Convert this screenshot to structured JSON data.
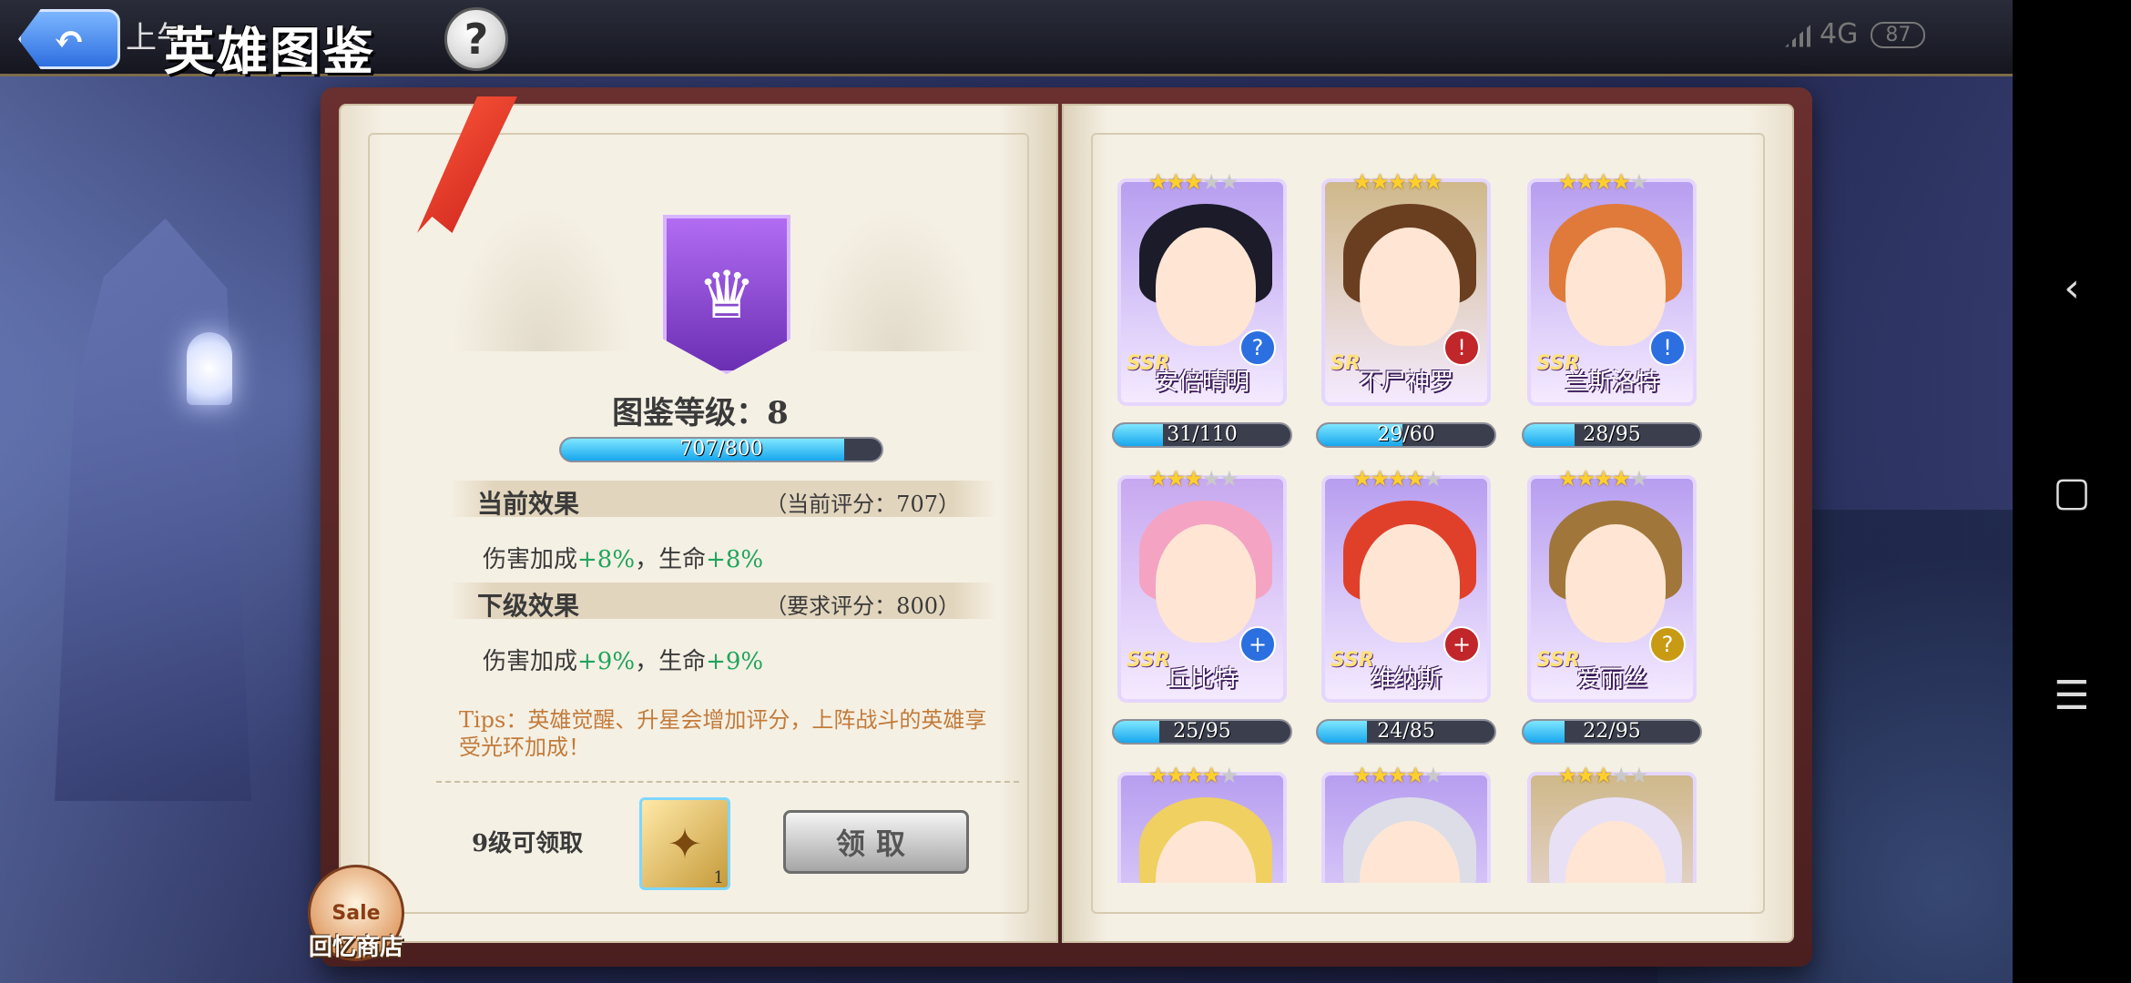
{
  "header": {
    "title": "英雄图鉴",
    "status_time": "上午",
    "network": "4G",
    "battery": "87"
  },
  "left_page": {
    "level_label": "图鉴等级：8",
    "progress_text": "707/800",
    "progress": 0.884,
    "current_effect": {
      "title": "当前效果",
      "score": "（当前评分：707）"
    },
    "current_effect_line": {
      "a": "伤害加成",
      "a_val": "+8%",
      "sep": "，生命",
      "b_val": "+8%"
    },
    "next_effect": {
      "title": "下级效果",
      "score": "（要求评分：800）"
    },
    "next_effect_line": {
      "a": "伤害加成",
      "a_val": "+9%",
      "sep": "，生命",
      "b_val": "+9%"
    },
    "tips": "Tips：英雄觉醒、升星会增加评分，上阵战斗的英雄享受光环加成！",
    "reward_label": "9级可领取",
    "reward_count": "1",
    "claim_button": "领取",
    "sale_badge": "Sale",
    "sale_label": "回忆商店"
  },
  "heroes": [
    {
      "name": "安倍晴明",
      "rarity": "SSR",
      "stars": 3,
      "progress_text": "31/110",
      "progress": 0.28,
      "bg": "#b79ef0",
      "hair": "#1b1b2a",
      "role": "?",
      "role_color": "#2b6fe0"
    },
    {
      "name": "不尸神罗",
      "rarity": "SR",
      "stars": 5,
      "progress_text": "29/60",
      "progress": 0.48,
      "bg": "#cfb88a",
      "hair": "#6a3f20",
      "role": "!",
      "role_color": "#c0262a"
    },
    {
      "name": "兰斯洛特",
      "rarity": "SSR",
      "stars": 4,
      "progress_text": "28/95",
      "progress": 0.29,
      "bg": "#b79ef0",
      "hair": "#e07a3a",
      "role": "!",
      "role_color": "#2b6fe0"
    },
    {
      "name": "丘比特",
      "rarity": "SSR",
      "stars": 3,
      "progress_text": "25/95",
      "progress": 0.26,
      "bg": "#c7a8f0",
      "hair": "#f5a3c2",
      "role": "+",
      "role_color": "#2b6fe0"
    },
    {
      "name": "维纳斯",
      "rarity": "SSR",
      "stars": 4,
      "progress_text": "24/85",
      "progress": 0.28,
      "bg": "#b79ef0",
      "hair": "#e0402a",
      "role": "+",
      "role_color": "#c0262a"
    },
    {
      "name": "爱丽丝",
      "rarity": "SSR",
      "stars": 4,
      "progress_text": "22/95",
      "progress": 0.23,
      "bg": "#b79ef0",
      "hair": "#a0763a",
      "role": "?",
      "role_color": "#c99a14"
    },
    {
      "name": "",
      "rarity": "",
      "stars": 4,
      "progress_text": "",
      "progress": 0,
      "bg": "#b79ef0",
      "hair": "#f0d060",
      "role": "",
      "role_color": "#2b6fe0"
    },
    {
      "name": "",
      "rarity": "",
      "stars": 4,
      "progress_text": "",
      "progress": 0,
      "bg": "#b79ef0",
      "hair": "#dddde8",
      "role": "",
      "role_color": "#2b6fe0"
    },
    {
      "name": "",
      "rarity": "",
      "stars": 3,
      "progress_text": "",
      "progress": 0,
      "bg": "#cfb88a",
      "hair": "#e8e0f5",
      "role": "",
      "role_color": "#2b6fe0"
    }
  ],
  "navbar": {
    "back": "‹",
    "home": "▢",
    "menu": "☰"
  }
}
